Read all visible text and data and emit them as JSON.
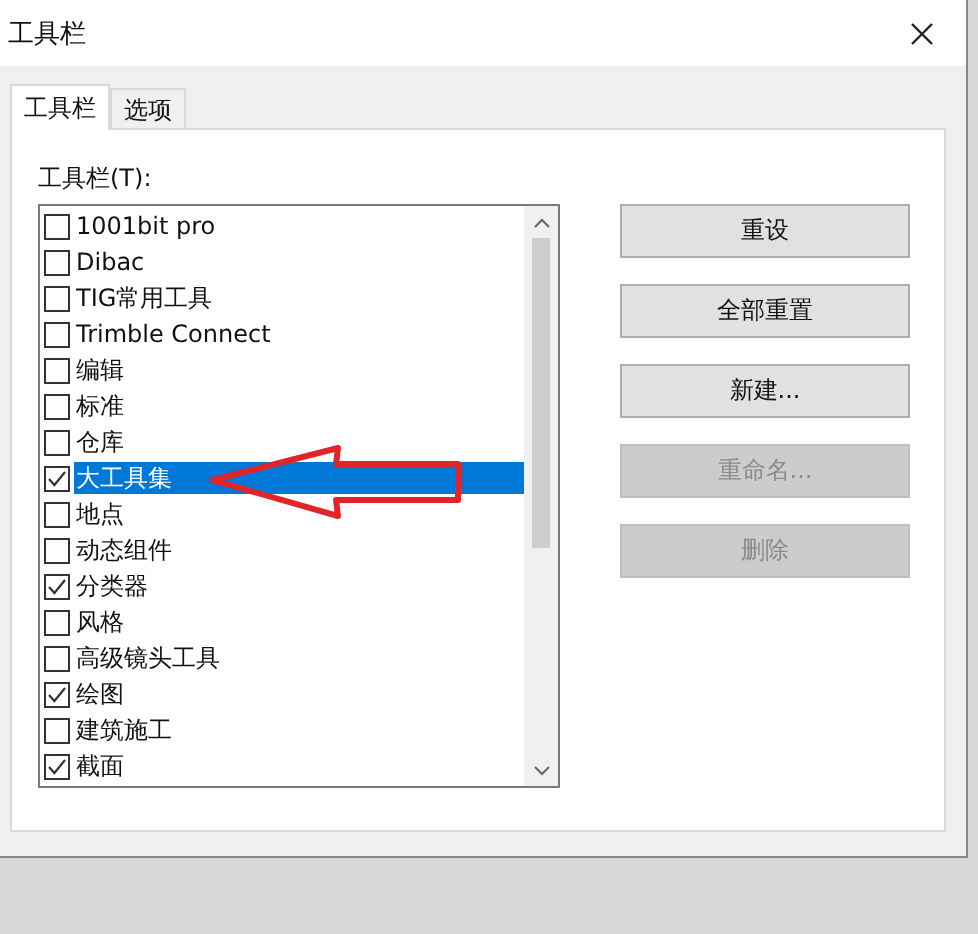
{
  "window": {
    "title": "工具栏"
  },
  "tabs": [
    {
      "label": "工具栏",
      "selected": true
    },
    {
      "label": "选项",
      "selected": false
    }
  ],
  "toolbar_list": {
    "label": "工具栏(T):",
    "items": [
      {
        "label": "1001bit pro",
        "checked": false,
        "selected": false
      },
      {
        "label": "Dibac",
        "checked": false,
        "selected": false
      },
      {
        "label": "TIG常用工具",
        "checked": false,
        "selected": false
      },
      {
        "label": "Trimble Connect",
        "checked": false,
        "selected": false
      },
      {
        "label": "编辑",
        "checked": false,
        "selected": false
      },
      {
        "label": "标准",
        "checked": false,
        "selected": false
      },
      {
        "label": "仓库",
        "checked": false,
        "selected": false
      },
      {
        "label": "大工具集",
        "checked": true,
        "selected": true
      },
      {
        "label": "地点",
        "checked": false,
        "selected": false
      },
      {
        "label": "动态组件",
        "checked": false,
        "selected": false
      },
      {
        "label": "分类器",
        "checked": true,
        "selected": false
      },
      {
        "label": "风格",
        "checked": false,
        "selected": false
      },
      {
        "label": "高级镜头工具",
        "checked": false,
        "selected": false
      },
      {
        "label": "绘图",
        "checked": true,
        "selected": false
      },
      {
        "label": "建筑施工",
        "checked": false,
        "selected": false
      },
      {
        "label": "截面",
        "checked": true,
        "selected": false
      }
    ]
  },
  "buttons": [
    {
      "label": "重设",
      "disabled": false
    },
    {
      "label": "全部重置",
      "disabled": false
    },
    {
      "label": "新建...",
      "disabled": false
    },
    {
      "label": "重命名...",
      "disabled": true
    },
    {
      "label": "删除",
      "disabled": true
    }
  ]
}
